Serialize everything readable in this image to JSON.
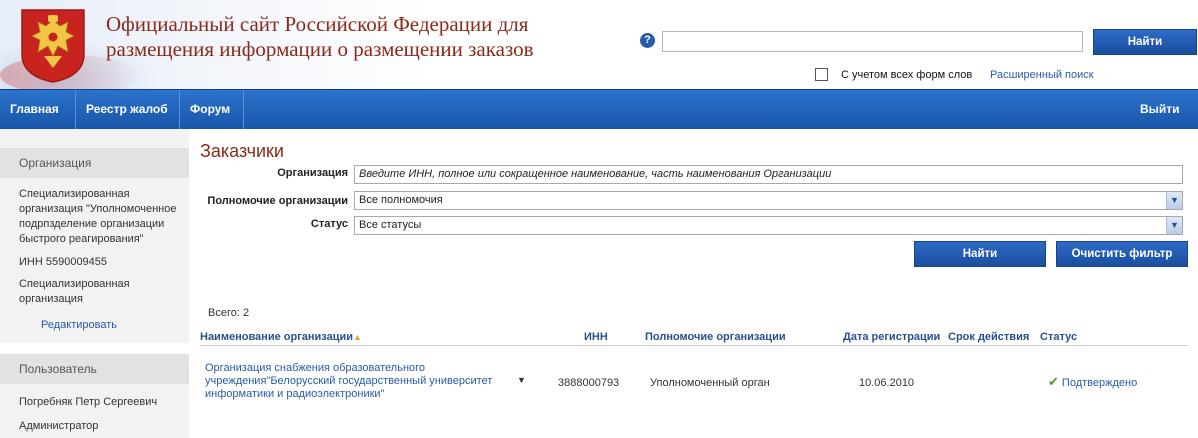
{
  "header": {
    "site_title": "Официальный сайт Российской Федерации для размещения информации о размещении заказов",
    "help_icon": "?",
    "search_placeholder": "",
    "search_button": "Найти",
    "word_forms_label": "С учетом всех форм слов",
    "advanced_search": "Расширенный поиск"
  },
  "nav": {
    "items": [
      "Главная",
      "Реестр жалоб",
      "Форум"
    ],
    "exit": "Выйти"
  },
  "sidebar": {
    "org_heading": "Организация",
    "org_name": "Специализированная организация \"Уполномоченное подрпзделение организации быстрого реагирования\"",
    "inn": "ИНН 5590009455",
    "org_type": "Специализированная организация",
    "edit_link": "Редактировать",
    "user_heading": "Пользователь",
    "user_name": "Погребняк Петр Сергеевич",
    "user_role": "Администратор"
  },
  "content": {
    "title": "Заказчики",
    "filters": {
      "org_label": "Организация",
      "org_placeholder": "Введите ИНН, полное или сокращенное наименование, часть наименования Организации",
      "power_label": "Полномочие организации",
      "power_value": "Все полномочия",
      "status_label": "Статус",
      "status_value": "Все статусы"
    },
    "find_button": "Найти",
    "clear_button": "Очистить фильтр",
    "total": "Всего: 2",
    "table": {
      "headers": {
        "name": "Наименование организации",
        "inn": "ИНН",
        "power": "Полномочие организации",
        "date": "Дата регистрации",
        "term": "Срок действия",
        "status": "Статус"
      },
      "rows": [
        {
          "name": "Организация снабжения образовательного учреждения\"Белорусский государственный университет информатики и радиоэлектроники\"",
          "inn": "3888000793",
          "power": "Уполномоченный орган",
          "date": "10.06.2010",
          "status": "Подтверждено"
        }
      ]
    }
  },
  "colors": {
    "accent_red": "#8b2a1a",
    "nav_blue": "#1f62b8",
    "link_blue": "#2a5aa8",
    "success_green": "#4aa02c"
  }
}
